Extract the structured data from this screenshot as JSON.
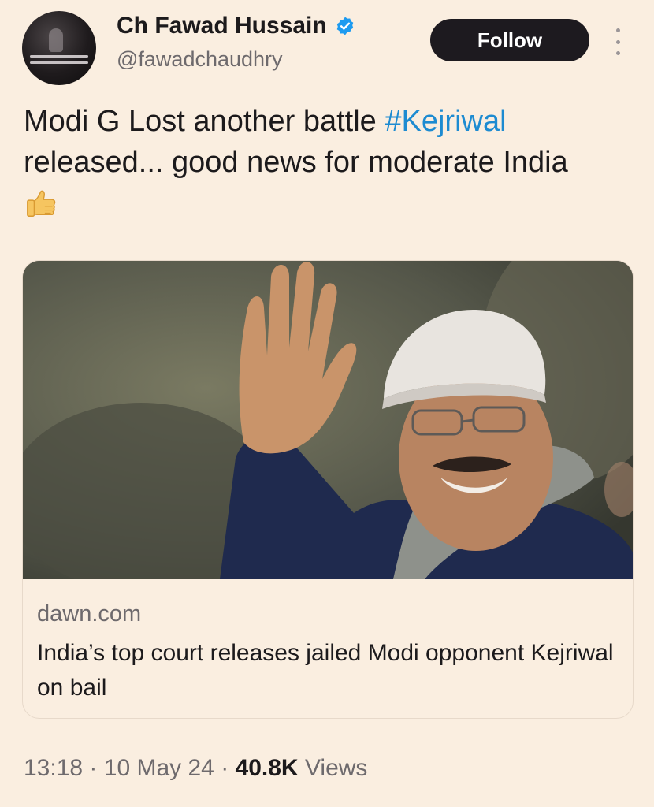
{
  "author": {
    "display_name": "Ch Fawad Hussain",
    "handle": "@fawadchaudhry",
    "verified_icon": "verified-badge-icon",
    "avatar_icon": "avatar"
  },
  "actions": {
    "follow_label": "Follow",
    "more_icon": "more-vertical-icon"
  },
  "tweet": {
    "text_before_hashtag": "Modi G Lost another battle ",
    "hashtag": "#Kejriwal",
    "text_after_hashtag": " released... good news for moderate India",
    "emoji_icon": "thumbs-up-icon"
  },
  "link_card": {
    "image_icon": "news-photo",
    "domain": "dawn.com",
    "headline": "India’s top court releases jailed Modi opponent Kejriwal on bail"
  },
  "meta": {
    "time": "13:18",
    "separator": "·",
    "date": "10 May 24",
    "views_count": "40.8K",
    "views_label": "Views"
  },
  "colors": {
    "background": "#faeee0",
    "hashtag": "#1d8bd1",
    "follow_button": "#1d1a1f",
    "verified": "#1d9bf0"
  }
}
